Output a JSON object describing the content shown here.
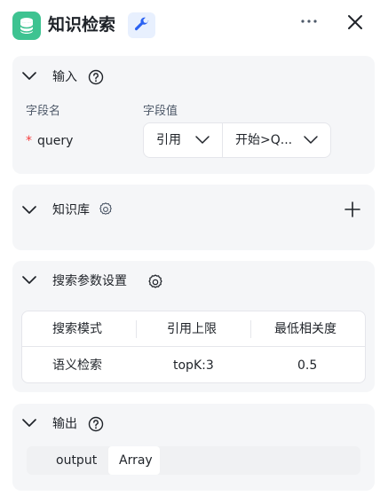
{
  "header": {
    "title": "知识检索",
    "app_icon": "database-icon",
    "tool_icon": "wrench-icon",
    "more_icon": "more-icon",
    "close_icon": "close-icon"
  },
  "input_section": {
    "title": "输入",
    "col_name": "字段名",
    "col_value": "字段值",
    "required_mark": "*",
    "field_name": "query",
    "ref_type": "引用",
    "ref_value": "开始>Q..."
  },
  "kb_section": {
    "title": "知识库"
  },
  "search_section": {
    "title": "搜索参数设置",
    "headers": [
      "搜索模式",
      "引用上限",
      "最低相关度"
    ],
    "row": [
      "语义检索",
      "topK:3",
      "0.5"
    ]
  },
  "output_section": {
    "title": "输出",
    "name": "output",
    "type": "Array"
  },
  "colors": {
    "accent_green": "#3ec391",
    "accent_blue": "#2b62f2",
    "required_red": "#f53f3f"
  }
}
